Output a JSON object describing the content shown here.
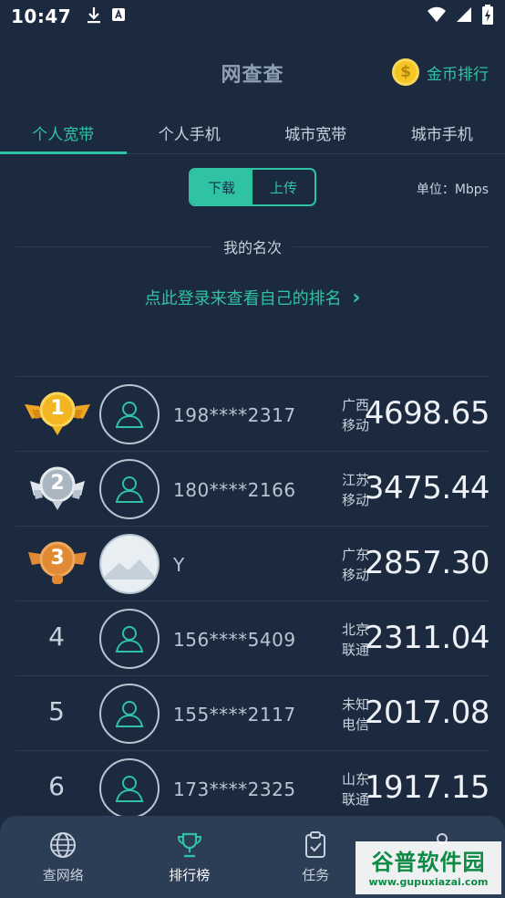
{
  "status": {
    "time": "10:47"
  },
  "header": {
    "title": "网查查",
    "coin_rank_label": "金币排行",
    "coin_symbol": "$"
  },
  "tabs": [
    {
      "label": "个人宽带",
      "active": true
    },
    {
      "label": "个人手机",
      "active": false
    },
    {
      "label": "城市宽带",
      "active": false
    },
    {
      "label": "城市手机",
      "active": false
    }
  ],
  "toggle": {
    "download_label": "下载",
    "upload_label": "上传",
    "selected": "下载"
  },
  "unit_label": "单位：Mbps",
  "my_rank": {
    "title": "我的名次",
    "login_link": "点此登录来查看自己的排名",
    "chevron": "›"
  },
  "rankings": [
    {
      "rank": "1",
      "name": "198****2317",
      "region_line1": "广西",
      "region_line2": "移动",
      "speed": "4698.65"
    },
    {
      "rank": "2",
      "name": "180****2166",
      "region_line1": "江苏",
      "region_line2": "移动",
      "speed": "3475.44"
    },
    {
      "rank": "3",
      "name": "Y",
      "region_line1": "广东",
      "region_line2": "移动",
      "speed": "2857.30"
    },
    {
      "rank": "4",
      "name": "156****5409",
      "region_line1": "北京",
      "region_line2": "联通",
      "speed": "2311.04"
    },
    {
      "rank": "5",
      "name": "155****2117",
      "region_line1": "未知",
      "region_line2": "电信",
      "speed": "2017.08"
    },
    {
      "rank": "6",
      "name": "173****2325",
      "region_line1": "山东",
      "region_line2": "联通",
      "speed": "1917.15"
    }
  ],
  "bottom_nav": [
    {
      "label": "查网络",
      "icon": "globe-icon"
    },
    {
      "label": "排行榜",
      "icon": "trophy-icon",
      "active": true
    },
    {
      "label": "任务",
      "icon": "clipboard-check-icon"
    },
    {
      "label": "",
      "icon": "profile-icon"
    }
  ],
  "watermark": {
    "main": "谷普软件园",
    "sub": "www.gupuxiazai.com"
  },
  "colors": {
    "background": "#1c2a3f",
    "accent": "#2fc3a3",
    "gold": "#f3b623",
    "silver": "#c9d0d8",
    "bronze": "#e08a34"
  }
}
